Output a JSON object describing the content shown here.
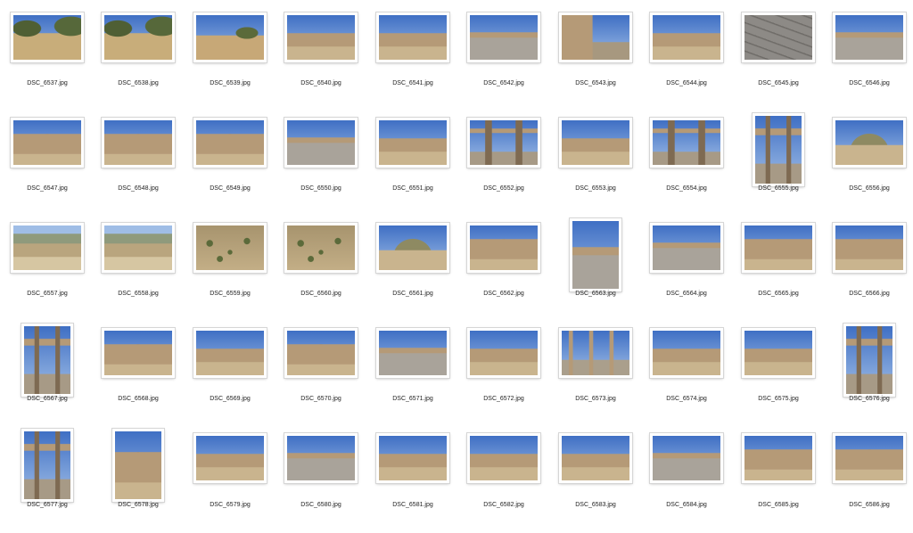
{
  "window": {
    "view": "icon-grid"
  },
  "photos": [
    {
      "name": "DSC_6537.jpg",
      "orientation": "landscape",
      "scene": "olive-trees"
    },
    {
      "name": "DSC_6538.jpg",
      "orientation": "landscape",
      "scene": "olive-trees"
    },
    {
      "name": "DSC_6539.jpg",
      "orientation": "landscape",
      "scene": "dry-field-ruin"
    },
    {
      "name": "DSC_6540.jpg",
      "orientation": "landscape",
      "scene": "ruins-wide"
    },
    {
      "name": "DSC_6541.jpg",
      "orientation": "landscape",
      "scene": "ruins-wide"
    },
    {
      "name": "DSC_6542.jpg",
      "orientation": "landscape",
      "scene": "paved-road"
    },
    {
      "name": "DSC_6543.jpg",
      "orientation": "landscape",
      "scene": "stone-wall"
    },
    {
      "name": "DSC_6544.jpg",
      "orientation": "landscape",
      "scene": "ruins-wide"
    },
    {
      "name": "DSC_6545.jpg",
      "orientation": "landscape",
      "scene": "paving-closeup"
    },
    {
      "name": "DSC_6546.jpg",
      "orientation": "landscape",
      "scene": "paved-road"
    },
    {
      "name": "DSC_6547.jpg",
      "orientation": "landscape",
      "scene": "temple"
    },
    {
      "name": "DSC_6548.jpg",
      "orientation": "landscape",
      "scene": "temple"
    },
    {
      "name": "DSC_6549.jpg",
      "orientation": "landscape",
      "scene": "temple"
    },
    {
      "name": "DSC_6550.jpg",
      "orientation": "landscape",
      "scene": "paved-road"
    },
    {
      "name": "DSC_6551.jpg",
      "orientation": "landscape",
      "scene": "ruins-wide"
    },
    {
      "name": "DSC_6552.jpg",
      "orientation": "landscape",
      "scene": "gate"
    },
    {
      "name": "DSC_6553.jpg",
      "orientation": "landscape",
      "scene": "ruins-wide"
    },
    {
      "name": "DSC_6554.jpg",
      "orientation": "landscape",
      "scene": "gate"
    },
    {
      "name": "DSC_6555.jpg",
      "orientation": "portrait",
      "scene": "gate"
    },
    {
      "name": "DSC_6556.jpg",
      "orientation": "landscape",
      "scene": "hills"
    },
    {
      "name": "DSC_6557.jpg",
      "orientation": "landscape",
      "scene": "plain"
    },
    {
      "name": "DSC_6558.jpg",
      "orientation": "landscape",
      "scene": "plain"
    },
    {
      "name": "DSC_6559.jpg",
      "orientation": "landscape",
      "scene": "olive-grove"
    },
    {
      "name": "DSC_6560.jpg",
      "orientation": "landscape",
      "scene": "olive-grove"
    },
    {
      "name": "DSC_6561.jpg",
      "orientation": "landscape",
      "scene": "hills"
    },
    {
      "name": "DSC_6562.jpg",
      "orientation": "landscape",
      "scene": "temple"
    },
    {
      "name": "DSC_6563.jpg",
      "orientation": "portrait",
      "scene": "paving-sky"
    },
    {
      "name": "DSC_6564.jpg",
      "orientation": "landscape",
      "scene": "paving-sky"
    },
    {
      "name": "DSC_6565.jpg",
      "orientation": "landscape",
      "scene": "temple"
    },
    {
      "name": "DSC_6566.jpg",
      "orientation": "landscape",
      "scene": "temple"
    },
    {
      "name": "DSC_6567.jpg",
      "orientation": "portrait",
      "scene": "gate"
    },
    {
      "name": "DSC_6568.jpg",
      "orientation": "landscape",
      "scene": "temple"
    },
    {
      "name": "DSC_6569.jpg",
      "orientation": "landscape",
      "scene": "ruins-wide"
    },
    {
      "name": "DSC_6570.jpg",
      "orientation": "landscape",
      "scene": "temple"
    },
    {
      "name": "DSC_6571.jpg",
      "orientation": "landscape",
      "scene": "paved-road"
    },
    {
      "name": "DSC_6572.jpg",
      "orientation": "landscape",
      "scene": "ruins-wide"
    },
    {
      "name": "DSC_6573.jpg",
      "orientation": "landscape",
      "scene": "columns"
    },
    {
      "name": "DSC_6574.jpg",
      "orientation": "landscape",
      "scene": "ruins-wide"
    },
    {
      "name": "DSC_6575.jpg",
      "orientation": "landscape",
      "scene": "ruins-wide"
    },
    {
      "name": "DSC_6576.jpg",
      "orientation": "portrait",
      "scene": "gate"
    },
    {
      "name": "DSC_6577.jpg",
      "orientation": "portrait",
      "scene": "gate"
    },
    {
      "name": "DSC_6578.jpg",
      "orientation": "portrait",
      "scene": "temple"
    },
    {
      "name": "DSC_6579.jpg",
      "orientation": "landscape",
      "scene": "ruins-wide"
    },
    {
      "name": "DSC_6580.jpg",
      "orientation": "landscape",
      "scene": "paved-road"
    },
    {
      "name": "DSC_6581.jpg",
      "orientation": "landscape",
      "scene": "ruins-wide"
    },
    {
      "name": "DSC_6582.jpg",
      "orientation": "landscape",
      "scene": "ruins-wide"
    },
    {
      "name": "DSC_6583.jpg",
      "orientation": "landscape",
      "scene": "ruins-wide"
    },
    {
      "name": "DSC_6584.jpg",
      "orientation": "landscape",
      "scene": "paved-road"
    },
    {
      "name": "DSC_6585.jpg",
      "orientation": "landscape",
      "scene": "temple"
    },
    {
      "name": "DSC_6586.jpg",
      "orientation": "landscape",
      "scene": "temple"
    }
  ],
  "colors": {
    "sky_top": "#3f6fc4",
    "sky_bottom": "#9fbde6",
    "stone": "#b59a77",
    "stone_dark": "#7e6a52",
    "ground": "#c9b48e",
    "olive": "#5b6a3a"
  }
}
